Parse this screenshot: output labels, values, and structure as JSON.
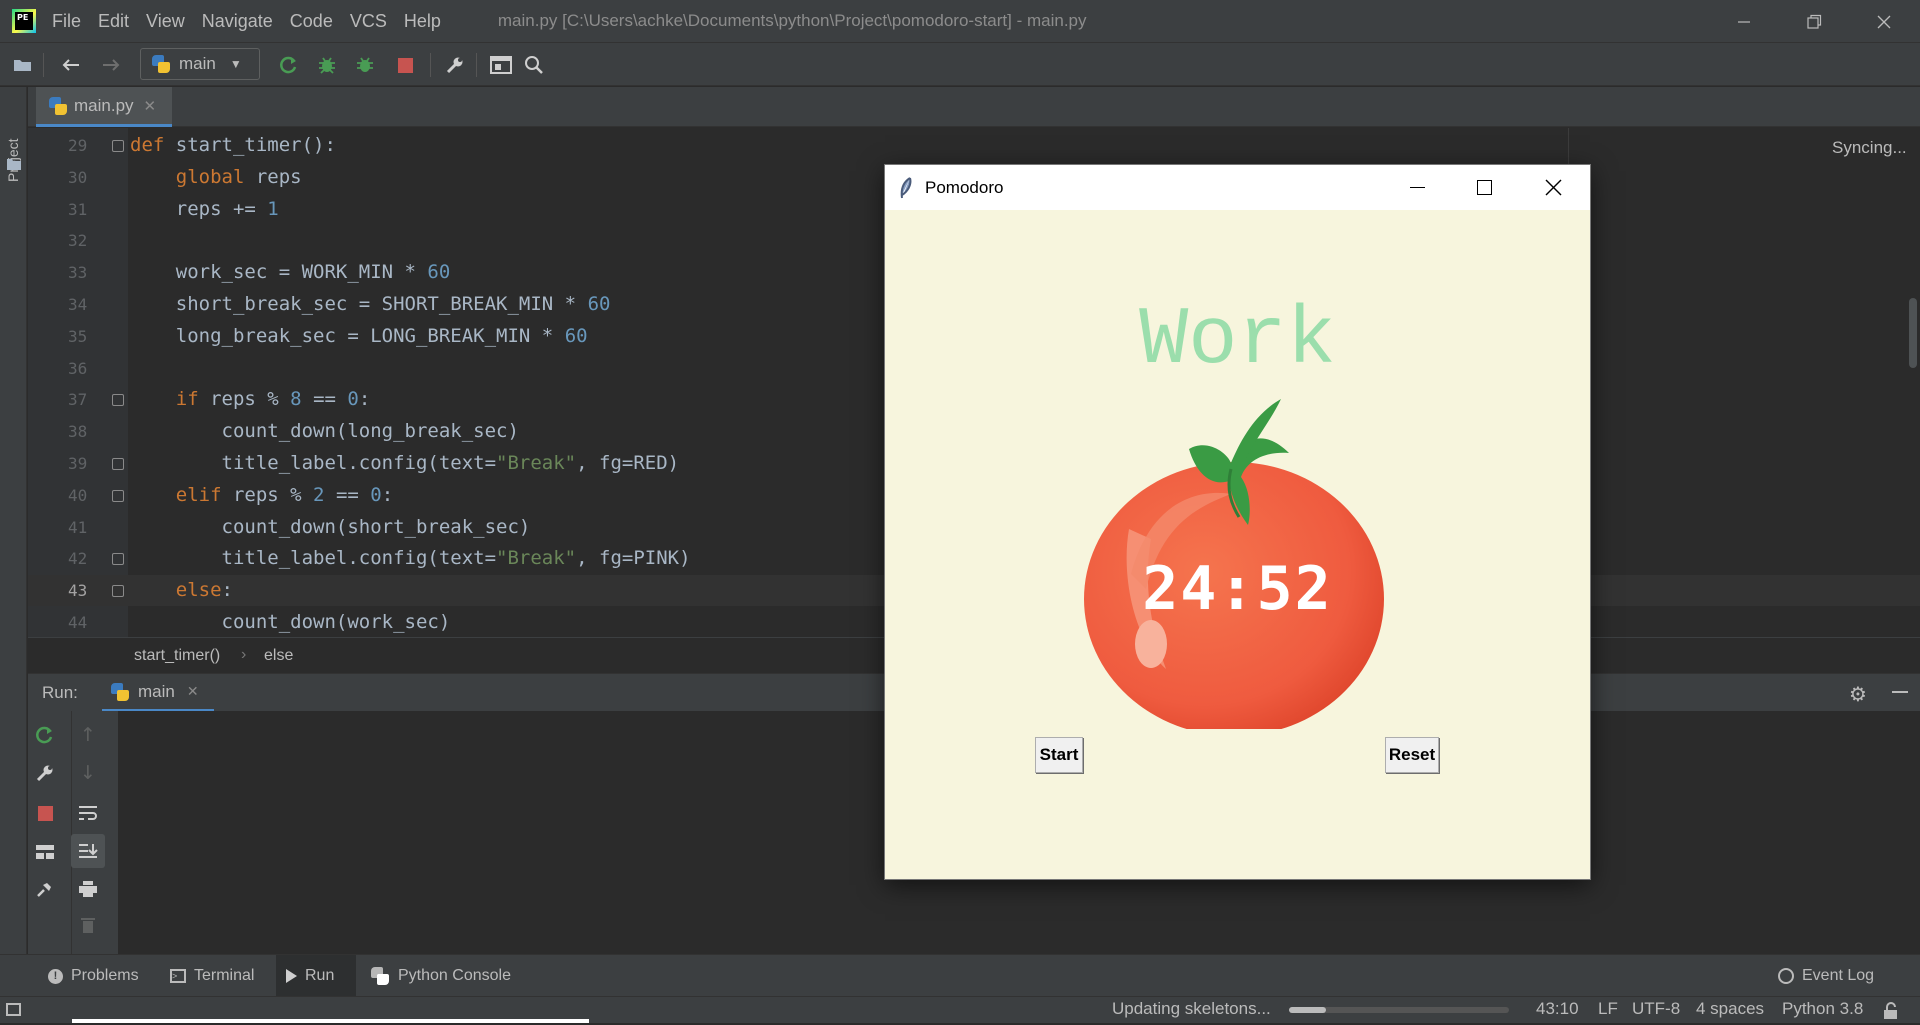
{
  "app": {
    "logo_text": "PE",
    "menu": [
      "File",
      "Edit",
      "View",
      "Navigate",
      "Code",
      "VCS",
      "Help"
    ],
    "window_title": "main.py [C:\\Users\\achke\\Documents\\python\\Project\\pomodoro-start] - main.py"
  },
  "toolbar": {
    "run_config": "main"
  },
  "left_strip": {
    "project_label": "Project"
  },
  "tabs": [
    {
      "label": "main.py"
    }
  ],
  "editor": {
    "status": "Syncing...",
    "lines": [
      {
        "num": "29",
        "html": "<span class='kw'>def</span> start_timer():"
      },
      {
        "num": "30",
        "html": "    <span class='kw'>global</span> reps"
      },
      {
        "num": "31",
        "html": "    reps += <span class='num'>1</span>"
      },
      {
        "num": "32",
        "html": ""
      },
      {
        "num": "33",
        "html": "    work_sec = WORK_MIN * <span class='num'>60</span>"
      },
      {
        "num": "34",
        "html": "    short_break_sec = SHORT_BREAK_MIN * <span class='num'>60</span>"
      },
      {
        "num": "35",
        "html": "    long_break_sec = LONG_BREAK_MIN * <span class='num'>60</span>"
      },
      {
        "num": "36",
        "html": ""
      },
      {
        "num": "37",
        "html": "    <span class='kw'>if</span> reps % <span class='num'>8</span> == <span class='num'>0</span>:"
      },
      {
        "num": "38",
        "html": "        count_down(long_break_sec)"
      },
      {
        "num": "39",
        "html": "        title_label.config(text=<span class='str'>\"Break\"</span>, fg=RED)"
      },
      {
        "num": "40",
        "html": "    <span class='kw'>elif</span> reps % <span class='num'>2</span> == <span class='num'>0</span>:"
      },
      {
        "num": "41",
        "html": "        count_down(short_break_sec)"
      },
      {
        "num": "42",
        "html": "        title_label.config(text=<span class='str'>\"Break\"</span>, fg=PINK)"
      },
      {
        "num": "43",
        "html": "    <span class='kw'>else</span>:"
      },
      {
        "num": "44",
        "html": "        count_down(work_sec)"
      }
    ],
    "current_line": "43"
  },
  "breadcrumbs": [
    "start_timer()",
    "else"
  ],
  "run_panel": {
    "label": "Run:",
    "tab": "main"
  },
  "bottom_tools": [
    "Problems",
    "Terminal",
    "Run",
    "Python Console"
  ],
  "event_log": "Event Log",
  "status_bar": {
    "task": "Updating skeletons...",
    "progress": 0.17,
    "position": "43:10",
    "line_sep": "LF",
    "encoding": "UTF-8",
    "indent": "4 spaces",
    "interpreter": "Python 3.8"
  },
  "pomodoro": {
    "title": "Pomodoro",
    "heading": "Work",
    "timer": "24:52",
    "start_label": "Start",
    "reset_label": "Reset",
    "heading_color": "#9bdeac",
    "bg_color": "#f7f5dd"
  }
}
